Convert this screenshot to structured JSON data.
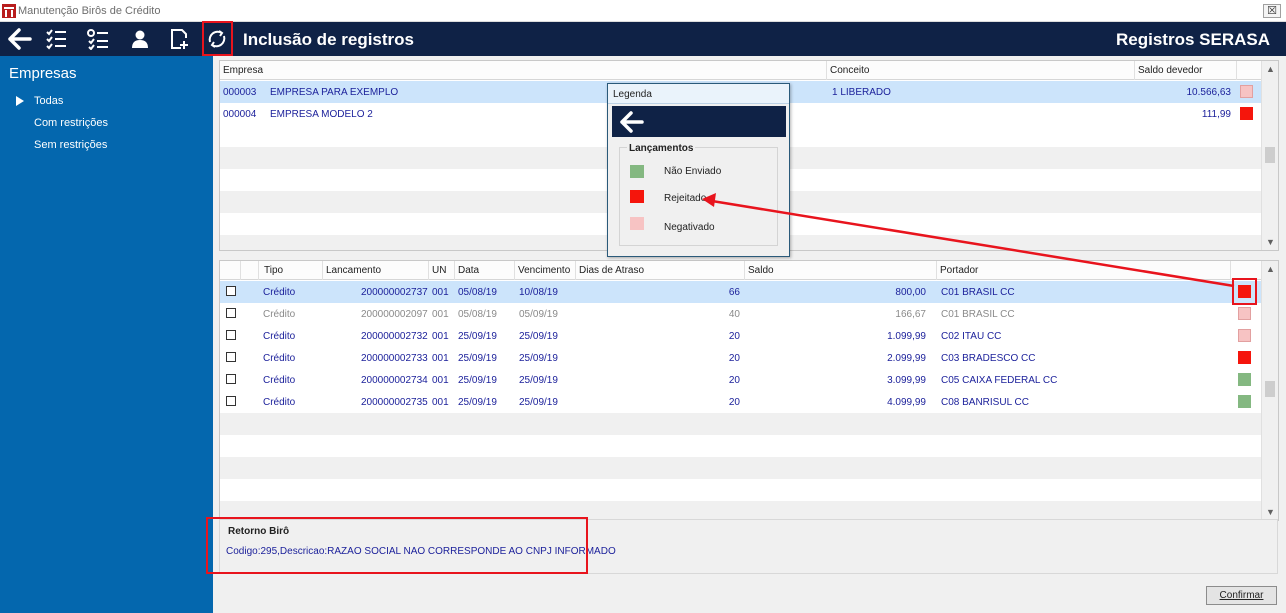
{
  "window": {
    "title": "Manutenção Birôs de Crédito",
    "close_label": "☒"
  },
  "colors": {
    "toolbar": "#0f2246",
    "sidebar": "#0467ae",
    "status_nao_enviado": "#84b881",
    "status_rejeitado": "#f5150c",
    "status_negativado": "#f7c3c3",
    "highlight": "#e8141d"
  },
  "toolbar": {
    "title": "Inclusão de registros",
    "right_title": "Registros SERASA",
    "icons": [
      "back-arrow-icon",
      "checklist-icon",
      "numbered-list-icon",
      "user-icon",
      "add-page-icon",
      "refresh-icon"
    ]
  },
  "sidebar": {
    "title": "Empresas",
    "items": [
      {
        "label": "Todas",
        "selected": true
      },
      {
        "label": "Com restrições"
      },
      {
        "label": "Sem restrições"
      }
    ]
  },
  "empresas_grid": {
    "columns": [
      "Empresa",
      "Conceito",
      "Saldo devedor"
    ],
    "rows": [
      {
        "code": "000003",
        "name": "EMPRESA PARA EXEMPLO",
        "conceito": "1  LIBERADO",
        "saldo": "10.566,63",
        "status": "negativado"
      },
      {
        "code": "000004",
        "name": "EMPRESA MODELO 2",
        "conceito": "",
        "saldo": "111,99",
        "status": "rejeitado"
      }
    ]
  },
  "lancamentos_grid": {
    "columns": [
      "Tipo",
      "Lancamento",
      "UN",
      "Data",
      "Vencimento",
      "Dias de Atraso",
      "Saldo",
      "Portador"
    ],
    "rows": [
      {
        "tipo": "Crédito",
        "lanc": "200000002737",
        "un": "001",
        "data": "05/08/19",
        "venc": "10/08/19",
        "dias": "66",
        "saldo": "800,00",
        "portador": "C01  BRASIL CC",
        "status": "rejeitado"
      },
      {
        "tipo": "Crédito",
        "lanc": "200000002097",
        "un": "001",
        "data": "05/08/19",
        "venc": "05/09/19",
        "dias": "40",
        "saldo": "166,67",
        "portador": "C01  BRASIL CC",
        "status": "negativado"
      },
      {
        "tipo": "Crédito",
        "lanc": "200000002732",
        "un": "001",
        "data": "25/09/19",
        "venc": "25/09/19",
        "dias": "20",
        "saldo": "1.099,99",
        "portador": "C02  ITAU CC",
        "status": "negativado"
      },
      {
        "tipo": "Crédito",
        "lanc": "200000002733",
        "un": "001",
        "data": "25/09/19",
        "venc": "25/09/19",
        "dias": "20",
        "saldo": "2.099,99",
        "portador": "C03  BRADESCO CC",
        "status": "rejeitado"
      },
      {
        "tipo": "Crédito",
        "lanc": "200000002734",
        "un": "001",
        "data": "25/09/19",
        "venc": "25/09/19",
        "dias": "20",
        "saldo": "3.099,99",
        "portador": "C05  CAIXA FEDERAL CC",
        "status": "nao_enviado"
      },
      {
        "tipo": "Crédito",
        "lanc": "200000002735",
        "un": "001",
        "data": "25/09/19",
        "venc": "25/09/19",
        "dias": "20",
        "saldo": "4.099,99",
        "portador": "C08  BANRISUL CC",
        "status": "nao_enviado"
      }
    ]
  },
  "legend": {
    "title": "Legenda",
    "group_title": "Lançamentos",
    "items": [
      {
        "label": "Não Enviado",
        "status": "nao_enviado"
      },
      {
        "label": "Rejeitado",
        "status": "rejeitado"
      },
      {
        "label": "Negativado",
        "status": "negativado"
      }
    ]
  },
  "retorno": {
    "title": "Retorno Birô",
    "message": "Codigo:295,Descricao:RAZAO SOCIAL NAO CORRESPONDE AO CNPJ INFORMADO"
  },
  "buttons": {
    "confirm_label": "Confirmar"
  }
}
